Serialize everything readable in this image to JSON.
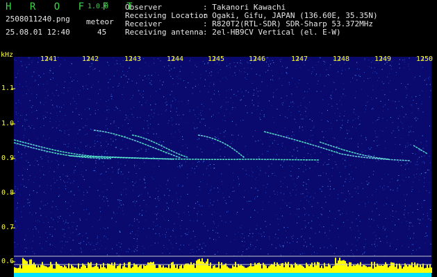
{
  "header": {
    "app_name": "H R O F F T",
    "version": "1.0.0",
    "filename": "2508011240.png",
    "timestamp": "25.08.01 12:40",
    "meteor_label": "meteor",
    "meteor_count": "45",
    "info": [
      {
        "label": "Observer",
        "value": ": Takanori Kawachi"
      },
      {
        "label": "Receiving Location",
        "value": ": Ogaki, Gifu, JAPAN (136.60E, 35.35N)"
      },
      {
        "label": "Receiver",
        "value": ": R820T2(RTL-SDR) SDR-Sharp 53.372MHz"
      },
      {
        "label": "Receiving antenna",
        "value": ": 2el-HB9CV Vertical (el. E-W)"
      }
    ]
  },
  "spectrogram": {
    "y_unit": "kHz",
    "y_ticks": [
      "1.1",
      "1.0",
      "0.9",
      "0.8",
      "0.7",
      "0.6"
    ],
    "x_ticks": [
      "1241",
      "1242",
      "1243",
      "1244",
      "1245",
      "1246",
      "1247",
      "1248",
      "1249",
      "1250"
    ],
    "colors": {
      "background": "#0a0a6e",
      "axis": "#ffff33",
      "trace": "#66ffdd",
      "level": "#ffff00",
      "level_base": "#00e0ff"
    }
  }
}
